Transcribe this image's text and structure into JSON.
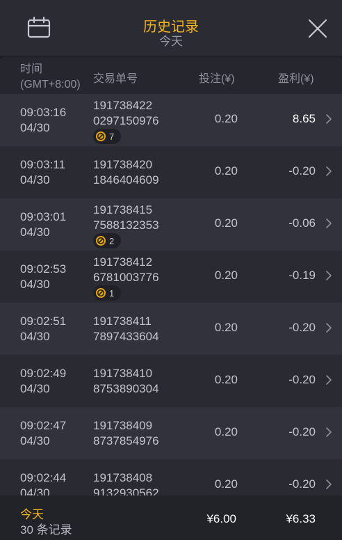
{
  "header": {
    "title": "历史记录",
    "subtitle": "今天"
  },
  "columns": {
    "time_line1": "时间",
    "time_line2": "(GMT+8:00)",
    "order": "交易单号",
    "bet": "投注(¥)",
    "profit": "盈利(¥)"
  },
  "rows": [
    {
      "time": "09:03:16",
      "date": "04/30",
      "order1": "191738422",
      "order2": "0297150976",
      "badge": "7",
      "bet": "0.20",
      "profit": "8.65",
      "positive": true
    },
    {
      "time": "09:03:11",
      "date": "04/30",
      "order1": "191738420",
      "order2": "1846404609",
      "badge": "",
      "bet": "0.20",
      "profit": "-0.20",
      "positive": false
    },
    {
      "time": "09:03:01",
      "date": "04/30",
      "order1": "191738415",
      "order2": "7588132353",
      "badge": "2",
      "bet": "0.20",
      "profit": "-0.06",
      "positive": false
    },
    {
      "time": "09:02:53",
      "date": "04/30",
      "order1": "191738412",
      "order2": "6781003776",
      "badge": "1",
      "bet": "0.20",
      "profit": "-0.19",
      "positive": false
    },
    {
      "time": "09:02:51",
      "date": "04/30",
      "order1": "191738411",
      "order2": "7897433604",
      "badge": "",
      "bet": "0.20",
      "profit": "-0.20",
      "positive": false
    },
    {
      "time": "09:02:49",
      "date": "04/30",
      "order1": "191738410",
      "order2": "8753890304",
      "badge": "",
      "bet": "0.20",
      "profit": "-0.20",
      "positive": false
    },
    {
      "time": "09:02:47",
      "date": "04/30",
      "order1": "191738409",
      "order2": "8737854976",
      "badge": "",
      "bet": "0.20",
      "profit": "-0.20",
      "positive": false
    },
    {
      "time": "09:02:44",
      "date": "04/30",
      "order1": "191738408",
      "order2": "9132930562",
      "badge": "",
      "bet": "0.20",
      "profit": "-0.20",
      "positive": false
    }
  ],
  "footer": {
    "label": "今天",
    "count": "30 条记录",
    "total_bet": "¥6.00",
    "total_profit": "¥6.33"
  },
  "colors": {
    "accent": "#f4b321",
    "background": "#26262e"
  }
}
